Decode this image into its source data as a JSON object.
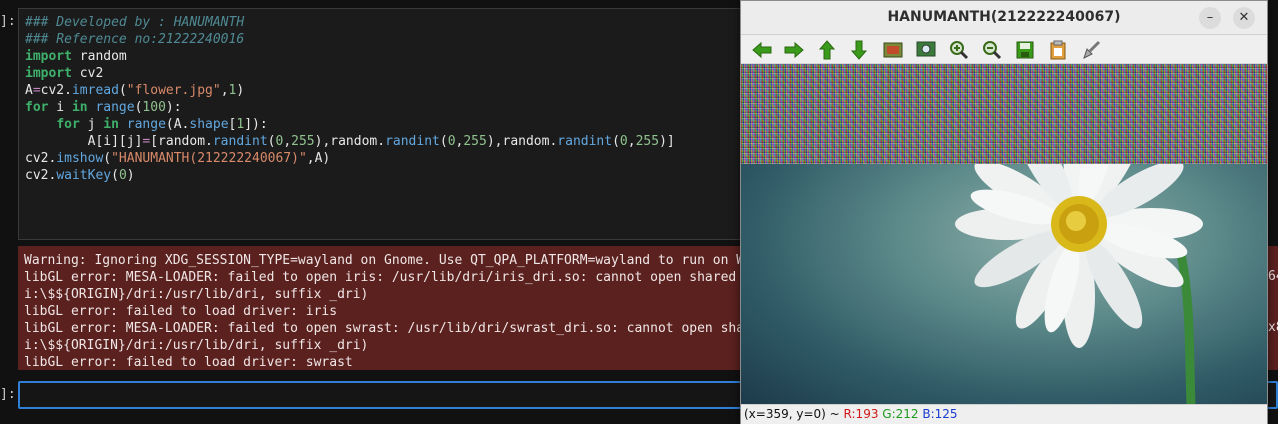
{
  "prompts": {
    "in_cell": "]:",
    "next_cell": "]:"
  },
  "code": {
    "lines": [
      [
        {
          "t": "### Developed by : HANUMANTH",
          "c": "cm"
        }
      ],
      [
        {
          "t": "### Reference no:21222240016",
          "c": "cm"
        }
      ],
      [
        {
          "t": "import",
          "c": "kw"
        },
        {
          "t": " random",
          "c": ""
        }
      ],
      [
        {
          "t": "import",
          "c": "kw"
        },
        {
          "t": " cv2",
          "c": ""
        }
      ],
      [
        {
          "t": "A",
          "c": ""
        },
        {
          "t": "=",
          "c": "op"
        },
        {
          "t": "cv2.",
          "c": ""
        },
        {
          "t": "imread",
          "c": "fn"
        },
        {
          "t": "(",
          "c": ""
        },
        {
          "t": "\"flower.jpg\"",
          "c": "st"
        },
        {
          "t": ",",
          "c": ""
        },
        {
          "t": "1",
          "c": "nm"
        },
        {
          "t": ")",
          "c": ""
        }
      ],
      [
        {
          "t": "for",
          "c": "kw"
        },
        {
          "t": " i ",
          "c": ""
        },
        {
          "t": "in",
          "c": "kw"
        },
        {
          "t": " ",
          "c": ""
        },
        {
          "t": "range",
          "c": "fn"
        },
        {
          "t": "(",
          "c": ""
        },
        {
          "t": "100",
          "c": "nm"
        },
        {
          "t": "):",
          "c": ""
        }
      ],
      [
        {
          "t": "    ",
          "c": ""
        },
        {
          "t": "for",
          "c": "kw"
        },
        {
          "t": " j ",
          "c": ""
        },
        {
          "t": "in",
          "c": "kw"
        },
        {
          "t": " ",
          "c": ""
        },
        {
          "t": "range",
          "c": "fn"
        },
        {
          "t": "(A.",
          "c": ""
        },
        {
          "t": "shape",
          "c": "fn"
        },
        {
          "t": "[",
          "c": ""
        },
        {
          "t": "1",
          "c": "nm"
        },
        {
          "t": "]):",
          "c": ""
        }
      ],
      [
        {
          "t": "        A[i][j]",
          "c": ""
        },
        {
          "t": "=",
          "c": "op"
        },
        {
          "t": "[random.",
          "c": ""
        },
        {
          "t": "randint",
          "c": "fn"
        },
        {
          "t": "(",
          "c": ""
        },
        {
          "t": "0",
          "c": "nm"
        },
        {
          "t": ",",
          "c": ""
        },
        {
          "t": "255",
          "c": "nm"
        },
        {
          "t": "),random.",
          "c": ""
        },
        {
          "t": "randint",
          "c": "fn"
        },
        {
          "t": "(",
          "c": ""
        },
        {
          "t": "0",
          "c": "nm"
        },
        {
          "t": ",",
          "c": ""
        },
        {
          "t": "255",
          "c": "nm"
        },
        {
          "t": "),random.",
          "c": ""
        },
        {
          "t": "randint",
          "c": "fn"
        },
        {
          "t": "(",
          "c": ""
        },
        {
          "t": "0",
          "c": "nm"
        },
        {
          "t": ",",
          "c": ""
        },
        {
          "t": "255",
          "c": "nm"
        },
        {
          "t": ")]",
          "c": ""
        }
      ],
      [
        {
          "t": "cv2.",
          "c": ""
        },
        {
          "t": "imshow",
          "c": "fn"
        },
        {
          "t": "(",
          "c": ""
        },
        {
          "t": "\"HANUMANTH(212222240067)\"",
          "c": "st"
        },
        {
          "t": ",A)",
          "c": ""
        }
      ],
      [
        {
          "t": "cv2.",
          "c": ""
        },
        {
          "t": "waitKey",
          "c": "fn"
        },
        {
          "t": "(",
          "c": ""
        },
        {
          "t": "0",
          "c": "nm"
        },
        {
          "t": ")",
          "c": ""
        }
      ]
    ]
  },
  "output": {
    "lines": [
      "Warning: Ignoring XDG_SESSION_TYPE=wayland on Gnome. Use QT_QPA_PLATFORM=wayland to run on W",
      "libGL error: MESA-LOADER: failed to open iris: /usr/lib/dri/iris_dri.so: cannot open shared",
      "i:\\$${ORIGIN}/dri:/usr/lib/dri, suffix _dri)",
      "libGL error: failed to load driver: iris",
      "libGL error: MESA-LOADER: failed to open swrast: /usr/lib/dri/swrast_dri.so: cannot open sha",
      "i:\\$${ORIGIN}/dri:/usr/lib/dri, suffix _dri)",
      "libGL error: failed to load driver: swrast"
    ],
    "right_fragments": [
      "64",
      "x86"
    ]
  },
  "cv_window": {
    "title": "HANUMANTH(212222240067)",
    "minimize_glyph": "–",
    "close_glyph": "✕",
    "toolbar_icons": [
      "arrow-left-icon",
      "arrow-right-icon",
      "arrow-up-icon",
      "arrow-down-icon",
      "image-icon",
      "zoom-fit-icon",
      "zoom-in-icon",
      "zoom-out-icon",
      "save-icon",
      "properties-icon",
      "brush-icon"
    ],
    "status": {
      "coords": "(x=359, y=0) ~",
      "r": "R:193",
      "g": "G:212",
      "b": "B:125"
    },
    "colors": {
      "icon_green": "#3a9a1a",
      "icon_dark": "#555555"
    }
  }
}
